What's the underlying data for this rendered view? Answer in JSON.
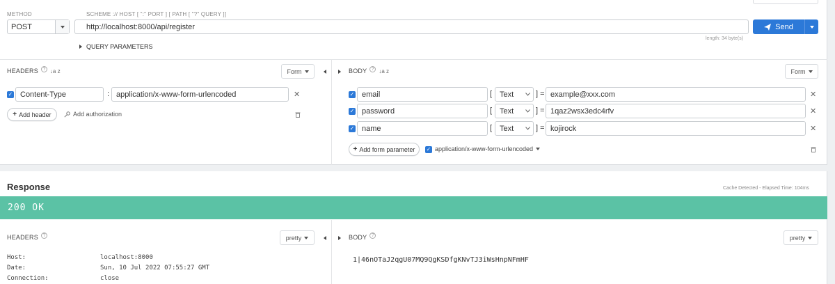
{
  "request": {
    "method_label": "METHOD",
    "method_value": "POST",
    "url_label": "SCHEME :// HOST [ \":\" PORT ] [ PATH [ \"?\" QUERY ]]",
    "url_value": "http://localhost:8000/api/register",
    "length_note": "length: 34 byte(s)",
    "send_label": "Send",
    "query_params_label": "QUERY PARAMETERS"
  },
  "headers": {
    "title": "HEADERS",
    "help_glyph": "?",
    "sort_glyph": "↓a z",
    "format_label": "Form",
    "items": [
      {
        "key": "Content-Type",
        "separator": ":",
        "value": "application/x-www-form-urlencoded",
        "checked": true
      }
    ],
    "add_header_label": "Add header",
    "add_auth_label": "Add authorization"
  },
  "body": {
    "title": "BODY",
    "help_glyph": "?",
    "sort_glyph": "↓a z",
    "format_label": "Form",
    "params": [
      {
        "key": "email",
        "type": "Text",
        "value": "example@xxx.com",
        "checked": true
      },
      {
        "key": "password",
        "type": "Text",
        "value": "1qaz2wsx3edc4rfv",
        "checked": true
      },
      {
        "key": "name",
        "type": "Text",
        "value": "kojirock",
        "checked": true
      }
    ],
    "open_bracket": "[",
    "close_bracket_eq": "] =",
    "add_param_label": "Add form parameter",
    "encoding_label": "application/x-www-form-urlencoded"
  },
  "response": {
    "title": "Response",
    "cache_note": "Cache Detected - Elapsed Time: 104ms",
    "status_text": "200 OK",
    "status_color": "#5bc2a5",
    "headers_title": "HEADERS",
    "headers_format": "pretty",
    "headers": [
      {
        "name": "Host:",
        "value": "localhost:8000"
      },
      {
        "name": "Date:",
        "value": "Sun, 10 Jul 2022 07:55:27 GMT"
      },
      {
        "name": "Connection:",
        "value": "close"
      }
    ],
    "body_title": "BODY",
    "body_format": "pretty",
    "body_text": "1|46nOTaJ2qgU07MQ9QgKSDfgKNvTJ3iWsHnpNFmHF"
  },
  "colors": {
    "accent": "#2c79d8",
    "status_bar": "#5bc2a5"
  }
}
